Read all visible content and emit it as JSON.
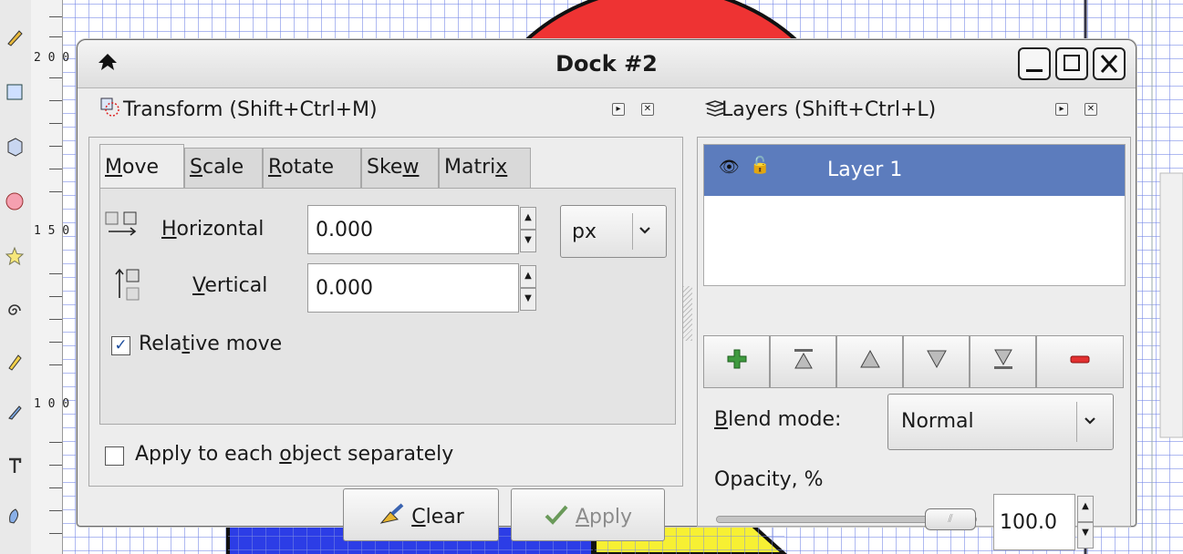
{
  "dock": {
    "title": "Dock #2",
    "minimize_label": "_",
    "maximize_label": "☐",
    "close_label": "✕"
  },
  "ruler": {
    "labels": [
      "2 0 0",
      "1 5 0",
      "1 0 0"
    ]
  },
  "transform": {
    "header": "Transform (Shift+Ctrl+M)",
    "tabs": [
      {
        "pre": "",
        "u": "M",
        "post": "ove"
      },
      {
        "pre": "",
        "u": "S",
        "post": "cale"
      },
      {
        "pre": "",
        "u": "R",
        "post": "otate"
      },
      {
        "pre": "Ske",
        "u": "w",
        "post": ""
      },
      {
        "pre": "Matri",
        "u": "x",
        "post": ""
      }
    ],
    "horizontal": {
      "pre": "",
      "u": "H",
      "post": "orizontal",
      "value": "0.000"
    },
    "vertical": {
      "pre": "",
      "u": "V",
      "post": "ertical",
      "value": "0.000"
    },
    "unit": "px",
    "relative_move": {
      "pre": "Rela",
      "u": "t",
      "post": "ive move",
      "checked": true
    },
    "apply_each": {
      "pre": "Apply to each ",
      "u": "o",
      "post": "bject separately",
      "checked": false
    },
    "clear_button": {
      "pre": "",
      "u": "C",
      "post": "lear"
    },
    "apply_button": {
      "pre": "",
      "u": "A",
      "post": "pply"
    }
  },
  "layers": {
    "header": "Layers (Shift+Ctrl+L)",
    "rows": [
      {
        "name": "Layer 1",
        "selected": true
      }
    ],
    "blend_mode_label": {
      "pre": "",
      "u": "B",
      "post": "lend mode:"
    },
    "blend_mode_value": "Normal",
    "opacity_label": "Opacity, %",
    "opacity_value": "100.0",
    "opacity_fraction": 1.0
  },
  "colors": {
    "selection": "#5c7cbd",
    "canvas_red": "#ee3333",
    "canvas_blue": "#2c3de6",
    "canvas_yellow": "#f7f033"
  }
}
